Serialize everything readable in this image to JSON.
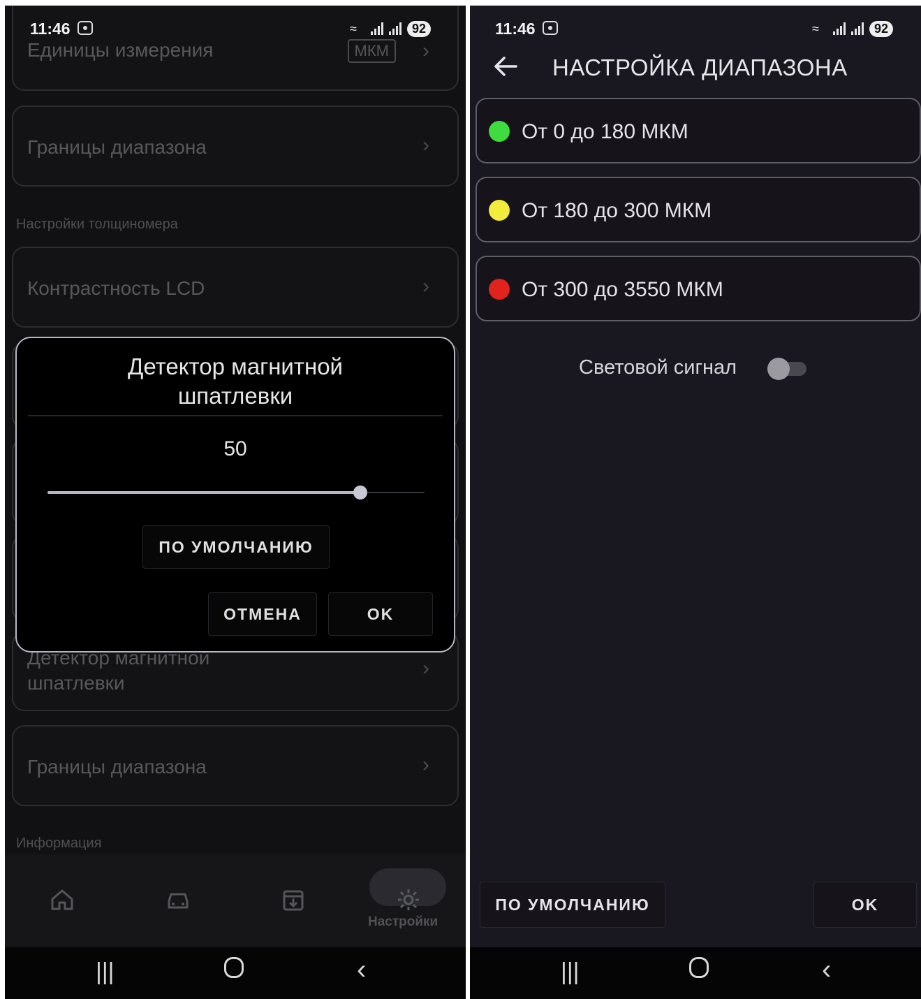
{
  "status_bar": {
    "time": "11:46",
    "battery": "92"
  },
  "left_screen": {
    "items": {
      "units_label": "Единицы измерения",
      "units_value": "МКМ",
      "range_limits_label": "Границы диапазона",
      "section_gauge": "Настройки толщиномера",
      "lcd_contrast_label": "Контрастность LCD",
      "magnetic_putty_label": "Детектор магнитной шпатлевки",
      "range_limits_label_2": "Границы диапазона",
      "section_info": "Информация"
    },
    "dialog": {
      "title_line1": "Детектор магнитной",
      "title_line2": "шпатлевки",
      "value": "50",
      "slider_fraction": 0.83,
      "default_button": "ПО УМОЛЧАНИЮ",
      "cancel_button": "ОТМЕНА",
      "ok_button": "OK"
    },
    "bottom_nav": {
      "items": [
        "home-icon",
        "car-icon",
        "download-box-icon",
        "gear-icon"
      ],
      "active_label": "Настройки"
    }
  },
  "right_screen": {
    "title": "НАСТРОЙКА ДИАПАЗОНА",
    "ranges": [
      {
        "text": "От 0 до 180 МКМ",
        "color": "#3fdc3f"
      },
      {
        "text": "От 180 до 300 МКМ",
        "color": "#f2ec3a"
      },
      {
        "text": "От 300 до 3550 МКМ",
        "color": "#e0231c"
      }
    ],
    "light_signal_label": "Световой сигнал",
    "light_signal_on": false,
    "default_button": "ПО УМОЛЧАНИЮ",
    "ok_button": "OK"
  }
}
